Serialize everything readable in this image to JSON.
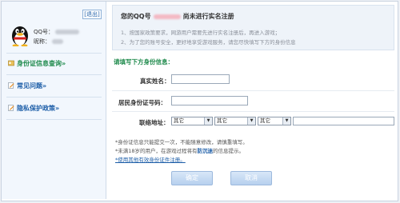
{
  "sidebar": {
    "logout_label": "[退出]",
    "qq_label": "QQ号：",
    "nickname_label": "昵称：",
    "links": [
      {
        "label": "身份证信息查询»",
        "color": "#1f8a4c",
        "icon": "id-card-icon"
      },
      {
        "label": "常见问题»",
        "color": "#1d5ea8",
        "icon": "pencil-icon"
      },
      {
        "label": "隐私保护政策»",
        "color": "#1d5ea8",
        "icon": "pencil-icon"
      }
    ]
  },
  "header": {
    "title_prefix": "您的QQ号",
    "title_suffix": "尚未进行实名注册",
    "notices": [
      "1、按国家政策要求，网游用户需要先进行实名注册后，再进入游戏；",
      "2、为了您的账号安全，更好地享受游戏服务，请您尽快填写下方的身份信息"
    ]
  },
  "form": {
    "section_title": "请填写下方身份信息：",
    "name_label": "真实姓名：",
    "id_label": "居民身份证号码：",
    "address_label": "联络地址：",
    "province_value": "其它",
    "city_value": "其它",
    "district_value": "其它"
  },
  "tips": {
    "line1": "*身份证信息只能提交一次，不能随意修改，请慎重填写。",
    "line2_prefix": "*未满18岁的用户，在游戏过程将有",
    "line2_highlight": "防沉迷",
    "line2_suffix": "的信息提示。",
    "line3": "*使用其他有效身份证件注册。"
  },
  "buttons": {
    "confirm": "确定",
    "cancel": "取消"
  },
  "colors": {
    "accent_green": "#1f8a4c",
    "link_blue": "#1d5ea8",
    "button_blue": "#b7d0ee"
  }
}
